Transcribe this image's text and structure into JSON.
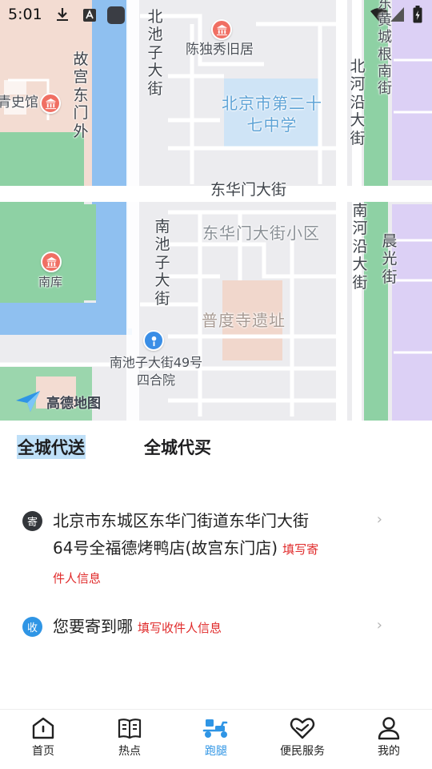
{
  "status_bar": {
    "time": "5:01"
  },
  "map": {
    "labels": {
      "chenduxiu": "陈独秀旧居",
      "beichizi": "北池子大街",
      "gugong_dongmenwai": "故宫东门外",
      "qingshiguan": "青史馆",
      "beijing27": "北京市第二十七中学",
      "beiheyan": "北河沿大街",
      "huangchenggen": "东黄城根南街",
      "donghuamen": "东华门大街",
      "donghuamen_xiaoqu": "东华门大街小区",
      "nanchizi": "南池子大街",
      "nanheyan": "南河沿大街",
      "chenguang": "晨光街",
      "nanku": "南库",
      "pudusi": "普度寺遗址",
      "siheyuan": "南池子大街49号四合院"
    },
    "logo_text": "高德地图",
    "colors": {
      "water": "#8fc0f0",
      "green": "#8ed1a4",
      "pink": "#f3dcd2",
      "purple": "#dcd0f5",
      "school": "#cfe4f6"
    }
  },
  "tabs": [
    {
      "label": "全城代送",
      "active": true
    },
    {
      "label": "全城代买",
      "active": false
    }
  ],
  "sender": {
    "badge": "寄",
    "address": "北京市东城区东华门街道东华门大街64号全福德烤鸭店(故宫东门店)",
    "hint": "填写寄件人信息"
  },
  "receiver": {
    "badge": "收",
    "prompt": "您要寄到哪",
    "hint": "填写收件人信息"
  },
  "nav": [
    {
      "label": "首页",
      "icon": "home-icon",
      "active": false
    },
    {
      "label": "热点",
      "icon": "book-icon",
      "active": false
    },
    {
      "label": "跑腿",
      "icon": "scooter-icon",
      "active": true
    },
    {
      "label": "便民服务",
      "icon": "heart-hand-icon",
      "active": false
    },
    {
      "label": "我的",
      "icon": "person-icon",
      "active": false
    }
  ],
  "accent": "#2f95e5"
}
